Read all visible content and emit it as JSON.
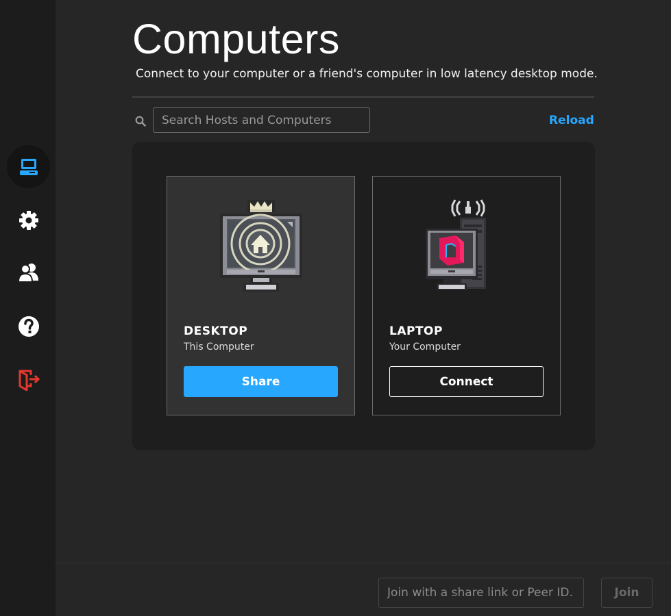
{
  "colors": {
    "accent": "#28a7ff",
    "logout": "#e5382d",
    "sidebar_bg": "#1c1c1c"
  },
  "sidebar": {
    "items": [
      {
        "icon": "computer-icon",
        "active": true
      },
      {
        "icon": "gear-icon"
      },
      {
        "icon": "users-icon"
      },
      {
        "icon": "help-icon"
      },
      {
        "icon": "logout-icon"
      }
    ]
  },
  "header": {
    "title": "Computers",
    "subtitle": "Connect to your computer or a friend's computer in low latency desktop mode."
  },
  "search": {
    "placeholder": "Search Hosts and Computers",
    "reload_label": "Reload"
  },
  "computers": [
    {
      "name": "DESKTOP",
      "subtitle": "This Computer",
      "action": "Share"
    },
    {
      "name": "LAPTOP",
      "subtitle": "Your Computer",
      "action": "Connect"
    }
  ],
  "footer": {
    "join_placeholder": "Join with a share link or Peer ID.",
    "join_label": "Join"
  }
}
